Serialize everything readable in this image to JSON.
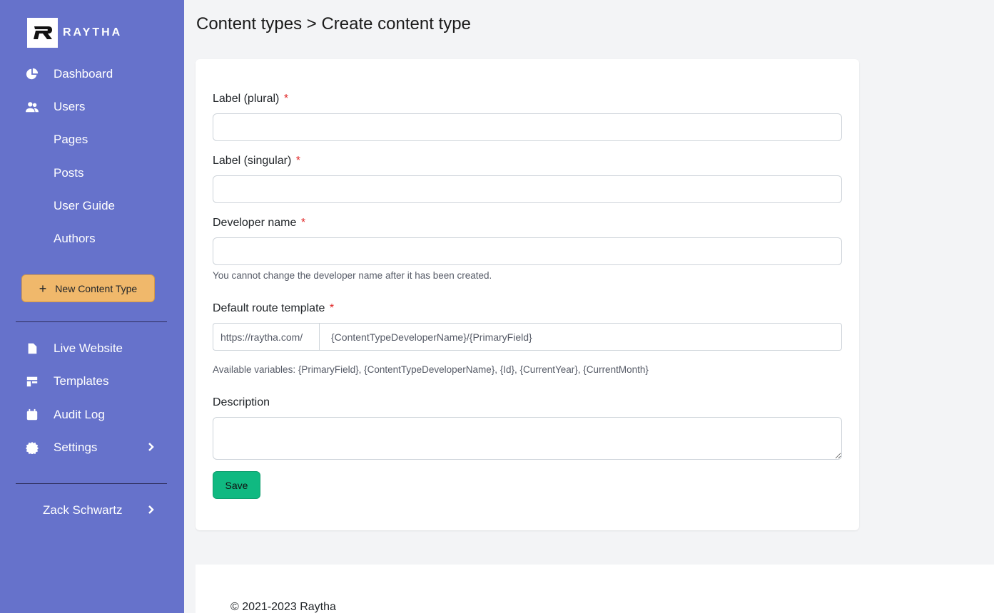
{
  "brand": {
    "name": "RAYTHA"
  },
  "sidebar": {
    "items": [
      {
        "label": "Dashboard",
        "icon": "dashboard-icon"
      },
      {
        "label": "Users",
        "icon": "users-icon"
      },
      {
        "label": "Pages",
        "icon": ""
      },
      {
        "label": "Posts",
        "icon": ""
      },
      {
        "label": "User Guide",
        "icon": ""
      },
      {
        "label": "Authors",
        "icon": ""
      }
    ],
    "new_content_type": "New Content Type",
    "secondary": [
      {
        "label": "Live Website",
        "icon": "file-icon"
      },
      {
        "label": "Templates",
        "icon": "templates-icon"
      },
      {
        "label": "Audit Log",
        "icon": "calendar-icon"
      },
      {
        "label": "Settings",
        "icon": "gear-icon"
      }
    ],
    "user": "Zack Schwartz"
  },
  "page": {
    "title": "Content types > Create content type"
  },
  "form": {
    "label_plural": "Label (plural)",
    "label_singular": "Label (singular)",
    "developer_name": "Developer name",
    "developer_help": "You cannot change the developer name after it has been created.",
    "route_template": "Default route template",
    "route_prefix": "https://raytha.com/",
    "route_value": "{ContentTypeDeveloperName}/{PrimaryField}",
    "route_help": "Available variables: {PrimaryField}, {ContentTypeDeveloperName}, {Id}, {CurrentYear}, {CurrentMonth}",
    "description": "Description",
    "required_mark": "*",
    "save": "Save"
  },
  "footer": {
    "text": "© 2021-2023 Raytha"
  },
  "colors": {
    "sidebar": "#6672cb",
    "accent_button": "#f0b86b",
    "save_button": "#10b981",
    "required": "#e02424"
  }
}
